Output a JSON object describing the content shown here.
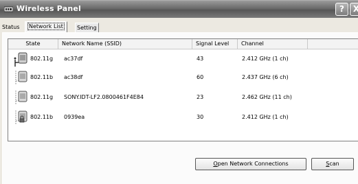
{
  "window": {
    "title": "Wireless Panel",
    "help_glyph": "?",
    "close_glyph": "X"
  },
  "tabs": {
    "status": "Status",
    "network_list": "Network List",
    "setting": "Setting"
  },
  "table": {
    "headers": [
      "State",
      "Network Name (SSID)",
      "Signal Level",
      "Channel"
    ],
    "rows": [
      {
        "state": "802.11g",
        "ssid": "ac37df",
        "signal": "43",
        "channel": "2.412 GHz (1 ch)",
        "icon": "network-connected-icon"
      },
      {
        "state": "802.11b",
        "ssid": "ac38df",
        "signal": "60",
        "channel": "2.437 GHz (6 ch)",
        "icon": "network-available-icon"
      },
      {
        "state": "802.11g",
        "ssid": "SONY.IDT-LF2.0800461F4E84",
        "signal": "23",
        "channel": "2.462 GHz (11 ch)",
        "icon": "network-available-icon"
      },
      {
        "state": "802.11b",
        "ssid": "0939ea",
        "signal": "30",
        "channel": "2.412 GHz (1 ch)",
        "icon": "network-locked-icon"
      }
    ]
  },
  "buttons": {
    "open_first": "O",
    "open_rest": "pen Network Connections",
    "scan_first": "S",
    "scan_rest": "can"
  }
}
